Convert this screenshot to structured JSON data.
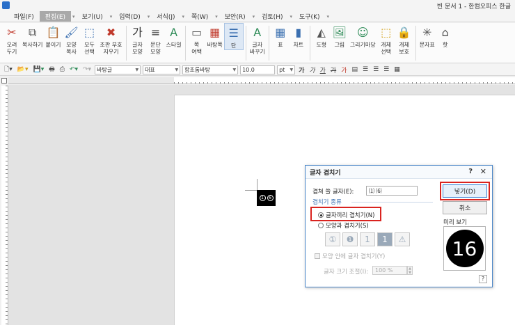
{
  "window": {
    "title": "빈 문서 1 - 한컴오피스 한글"
  },
  "menu": [
    {
      "label": "파일(F)",
      "active": false
    },
    {
      "label": "편집(E)",
      "active": true
    },
    {
      "label": "보기(U)",
      "active": false
    },
    {
      "label": "입력(D)",
      "active": false
    },
    {
      "label": "서식(J)",
      "active": false
    },
    {
      "label": "쪽(W)",
      "active": false
    },
    {
      "label": "보안(R)",
      "active": false
    },
    {
      "label": "검토(H)",
      "active": false
    },
    {
      "label": "도구(K)",
      "active": false
    }
  ],
  "ribbon": [
    {
      "label": "오려\n두기",
      "icon": "scissors-icon",
      "glyph": "✂",
      "color": "#c0392b"
    },
    {
      "label": "복사하기",
      "icon": "copy-icon",
      "glyph": "⧉",
      "color": "#555555"
    },
    {
      "label": "붙이기",
      "icon": "paste-icon",
      "glyph": "📋",
      "color": "#8a6d3b"
    },
    {
      "label": "모양\n복사",
      "icon": "format-painter-icon",
      "glyph": "🖌",
      "color": "#3a6fb0"
    },
    {
      "label": "모두\n선택",
      "icon": "select-all-icon",
      "glyph": "⬚",
      "color": "#3a6fb0"
    },
    {
      "label": "조판 부호\n지우기",
      "icon": "clear-markup-icon",
      "glyph": "✖",
      "color": "#c0392b"
    },
    {
      "label": "글자\n모양",
      "icon": "char-shape-icon",
      "glyph": "가",
      "color": "#333333"
    },
    {
      "label": "문단\n모양",
      "icon": "paragraph-shape-icon",
      "glyph": "≡",
      "color": "#333333"
    },
    {
      "label": "스타일",
      "icon": "style-icon",
      "glyph": "A",
      "color": "#2e8b57"
    },
    {
      "label": "쪽\n여백",
      "icon": "page-margin-icon",
      "glyph": "▭",
      "color": "#555555"
    },
    {
      "label": "바탕쪽",
      "icon": "master-page-icon",
      "glyph": "▦",
      "color": "#c0392b"
    },
    {
      "label": "단",
      "icon": "columns-icon",
      "glyph": "☰",
      "color": "#3a6fb0"
    },
    {
      "label": "글자\n바꾸기",
      "icon": "replace-char-icon",
      "glyph": "A",
      "color": "#2e8b57"
    },
    {
      "label": "표",
      "icon": "table-icon",
      "glyph": "▦",
      "color": "#3a6fb0"
    },
    {
      "label": "차트",
      "icon": "chart-icon",
      "glyph": "▮",
      "color": "#3a6fb0"
    },
    {
      "label": "도형",
      "icon": "shape-icon",
      "glyph": "◭",
      "color": "#555555"
    },
    {
      "label": "그림",
      "icon": "picture-icon",
      "glyph": "🖼",
      "color": "#2e8b57"
    },
    {
      "label": "그리기마당",
      "icon": "clipart-icon",
      "glyph": "☺",
      "color": "#2e8b57"
    },
    {
      "label": "개체\n선택",
      "icon": "object-select-icon",
      "glyph": "⬚",
      "color": "#d4a017"
    },
    {
      "label": "개체\n보호",
      "icon": "object-protect-icon",
      "glyph": "🔒",
      "color": "#d4a017"
    },
    {
      "label": "문자표",
      "icon": "symbol-icon",
      "glyph": "✳",
      "color": "#555555"
    },
    {
      "label": "핫",
      "icon": "more-icon",
      "glyph": "⌂",
      "color": "#555555"
    }
  ],
  "format_toolbar": {
    "style": "바탕글",
    "font_lang": "대표",
    "font": "함초롬바탕",
    "size": "10.0",
    "size_unit": "pt",
    "bold": "가",
    "italic": "가",
    "underline": "가",
    "strike": "가",
    "color": "가"
  },
  "document": {
    "overlap_sample": [
      "1",
      "6"
    ]
  },
  "dialog": {
    "title": "글자 겹치기",
    "help": "?",
    "close": "✕",
    "overlap_chars_label": "겹쳐 쓸 글자(E):",
    "overlap_chars_value": "⑴ ⑹",
    "kind_title": "겹치기 종류",
    "option_chars": "글자끼리 겹치기(N)",
    "option_shape": "모양과 겹치기(S)",
    "shapes": [
      "①",
      "❶",
      "1",
      "1",
      "⚠"
    ],
    "inside_checkbox": "모양 안에 글자 겹치기(Y)",
    "size_label": "글자 크기 조절(I):",
    "size_value": "100 %",
    "insert_button": "넣기(D)",
    "cancel_button": "취소",
    "preview_label": "미리 보기",
    "preview_value": "16",
    "help_button": "?"
  }
}
